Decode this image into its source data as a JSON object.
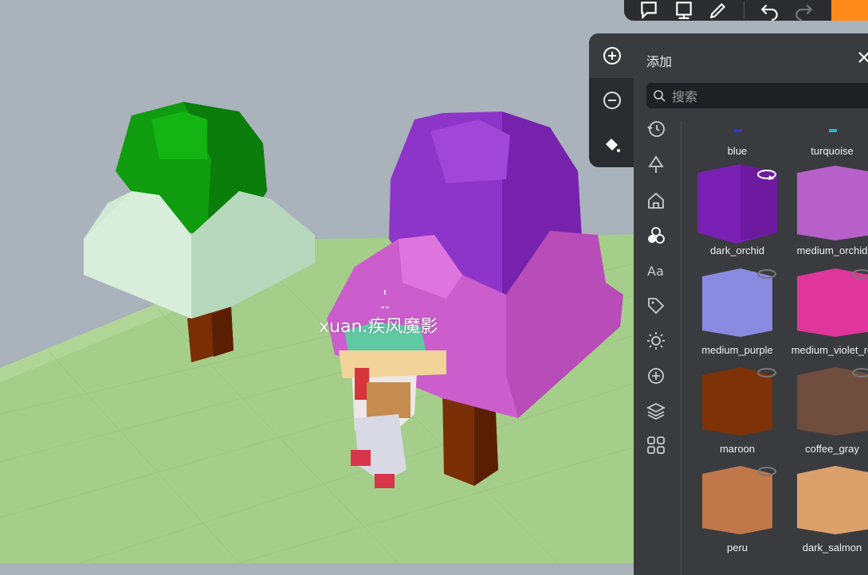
{
  "scene": {
    "player_name": "xuan.疾风魔影",
    "sky_color": "#a9b1bb",
    "ground_color": "#a6cf8d"
  },
  "toolbar": {
    "icons": [
      "comment-icon",
      "sign-icon",
      "edit-icon",
      "undo-icon",
      "redo-icon"
    ],
    "run_color": "#ff8a1a"
  },
  "tools": {
    "items": [
      {
        "name": "add-block-tool",
        "icon": "plus-circle-icon",
        "active": true
      },
      {
        "name": "remove-block-tool",
        "icon": "minus-circle-icon",
        "active": false
      },
      {
        "name": "paint-tool",
        "icon": "paint-bucket-icon",
        "active": false
      }
    ]
  },
  "panel": {
    "title": "添加",
    "search_placeholder": "搜索",
    "categories": [
      {
        "name": "recent",
        "icon": "history-icon"
      },
      {
        "name": "nature",
        "icon": "tree-icon"
      },
      {
        "name": "buildings",
        "icon": "house-icon"
      },
      {
        "name": "colors",
        "icon": "color-circles-icon",
        "active": true
      },
      {
        "name": "text",
        "icon": "text-aa-icon"
      },
      {
        "name": "tags",
        "icon": "tag-icon"
      },
      {
        "name": "lighting",
        "icon": "sun-icon"
      },
      {
        "name": "add",
        "icon": "plus-circle-icon"
      },
      {
        "name": "layers",
        "icon": "layers-icon"
      },
      {
        "name": "widgets",
        "icon": "grid-icon"
      }
    ],
    "items": [
      {
        "label": "blue",
        "color": "#2a3bd6"
      },
      {
        "label": "turquoise",
        "color": "#2ab3c9"
      },
      {
        "label": "dark_orchid",
        "color": "#7a1fb3"
      },
      {
        "label": "medium_orchid",
        "color": "#b760c9"
      },
      {
        "label": "medium_purple",
        "color": "#8a8ae0"
      },
      {
        "label": "medium_violet_re",
        "color": "#e0359a"
      },
      {
        "label": "maroon",
        "color": "#7e3208"
      },
      {
        "label": "coffee_gray",
        "color": "#6f4d3f"
      },
      {
        "label": "peru",
        "color": "#c0774a"
      },
      {
        "label": "dark_salmon",
        "color": "#dca06a"
      }
    ]
  }
}
